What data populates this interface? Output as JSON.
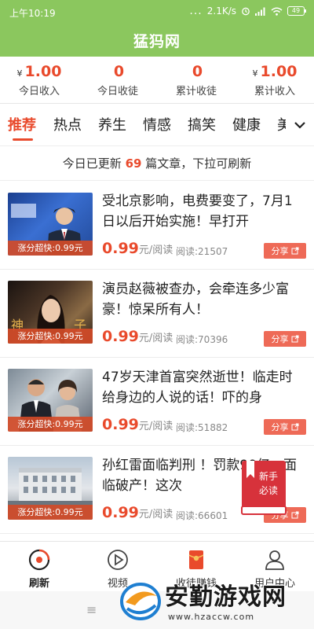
{
  "status_bar": {
    "time": "上午10:19",
    "dots": "...",
    "network_speed": "2.1K/s",
    "battery": "49"
  },
  "app": {
    "title": "猛犸网"
  },
  "stats": [
    {
      "currency": "¥",
      "value": "1.00",
      "label": "今日收入"
    },
    {
      "currency": "",
      "value": "0",
      "label": "今日收徒"
    },
    {
      "currency": "",
      "value": "0",
      "label": "累计收徒"
    },
    {
      "currency": "¥",
      "value": "1.00",
      "label": "累计收入"
    }
  ],
  "categories": [
    "推荐",
    "热点",
    "养生",
    "情感",
    "搞笑",
    "健康",
    "美"
  ],
  "active_category": "推荐",
  "notice": {
    "prefix": "今日已更新",
    "count": "69",
    "suffix": "篇文章，下拉可刷新"
  },
  "articles": [
    {
      "title": "受北京影响，电费要变了，7月1日以后开始实施！早打开",
      "tag": "涨分超快:0.99元",
      "price": "0.99",
      "price_unit": "元/阅读",
      "reads": "阅读:21507",
      "share": "分享",
      "thumb": "news-anchor"
    },
    {
      "title": "演员赵薇被查办，会牵连多少富豪！惊呆所有人！",
      "tag": "涨分超快:0.99元",
      "price": "0.99",
      "price_unit": "元/阅读",
      "reads": "阅读:70396",
      "share": "分享",
      "thumb": "portrait"
    },
    {
      "title": "47岁天津首富突然逝世！临走时给身边的人说的话！吓的身",
      "tag": "涨分超快:0.99元",
      "price": "0.99",
      "price_unit": "元/阅读",
      "reads": "阅读:51882",
      "share": "分享",
      "thumb": "couple"
    },
    {
      "title": "孙红雷面临判刑 ！罚款90亿，面临破产！这次",
      "tag": "涨分超快:0.99元",
      "price": "0.99",
      "price_unit": "元/阅读",
      "reads": "阅读:66601",
      "share": "分享",
      "thumb": "building"
    }
  ],
  "novice_badge": {
    "line1": "新手",
    "line2": "必读"
  },
  "bottom_nav": [
    {
      "label": "刷新",
      "icon": "refresh-icon"
    },
    {
      "label": "视频",
      "icon": "play-icon"
    },
    {
      "label": "收徒赚钱",
      "icon": "red-envelope-icon"
    },
    {
      "label": "用户中心",
      "icon": "user-icon"
    }
  ],
  "system_bar": {
    "menu_glyph": "≡"
  },
  "watermark": {
    "text": "安勤游戏网",
    "url": "www.hzaccw.com"
  },
  "colors": {
    "header_green": "#8bc75e",
    "accent_red": "#e94a2c",
    "share_red": "#ee6a57"
  }
}
